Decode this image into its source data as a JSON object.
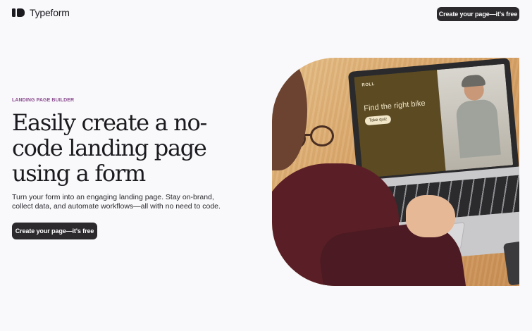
{
  "header": {
    "logo_text": "Typeform",
    "cta_label": "Create your page—it's free"
  },
  "hero": {
    "eyebrow": "LANDING PAGE BUILDER",
    "headline": "Easily create a no-code landing page using a form",
    "subtext": "Turn your form into an engaging landing page. Stay on-brand, collect data, and automate workflows—all with no need to code.",
    "cta_label": "Create your page—it's free"
  },
  "visual": {
    "screen_brand": "ROLL",
    "screen_title": "Find the right bike",
    "screen_button": "Take quiz"
  },
  "colors": {
    "background": "#f9f8fb",
    "button": "#2d2a2e",
    "eyebrow": "#8a4d8f",
    "text": "#1b1b1f"
  }
}
